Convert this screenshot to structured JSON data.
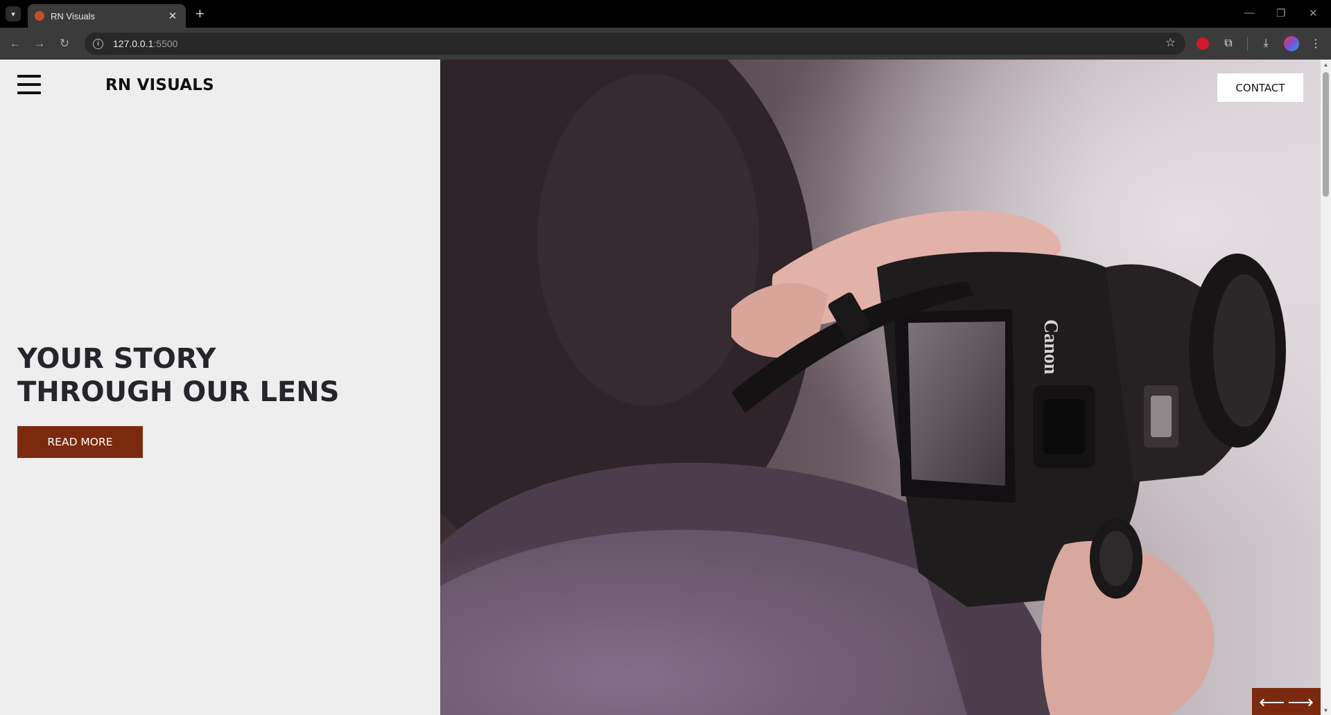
{
  "browser": {
    "tab_title": "RN Visuals",
    "url_host": "127.0.0.1",
    "url_port": ":5500",
    "icons": {
      "tab_search": "chevron-down-icon",
      "tab_close": "close-icon",
      "new_tab": "plus-icon",
      "back": "back-arrow-icon",
      "forward": "forward-arrow-icon",
      "reload": "reload-icon",
      "site_info": "info-icon",
      "bookmark": "star-icon",
      "extension": "extension-icon",
      "puzzle": "puzzle-icon",
      "download": "download-icon",
      "profile": "avatar",
      "menu": "kebab-menu-icon"
    }
  },
  "page": {
    "brand": "RN VISUALS",
    "headline_line1": "YOUR STORY",
    "headline_line2": "THROUGH OUR LENS",
    "read_more_label": "READ MORE",
    "contact_label": "CONTACT",
    "prev_arrow": "⟵",
    "next_arrow": "⟶",
    "hero_image_subject": "person holding a Canon camera",
    "camera_brand_text": "Canon",
    "colors": {
      "accent": "#7b2a10",
      "left_panel_bg": "#eeeeee",
      "headline": "#24262b"
    }
  }
}
